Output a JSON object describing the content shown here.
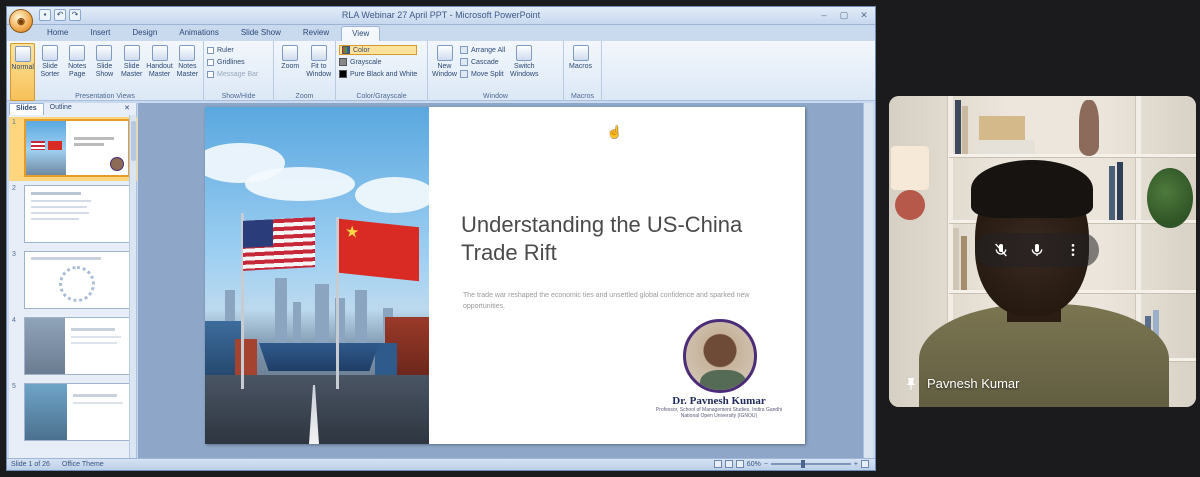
{
  "window": {
    "title": "RLA Webinar 27 April PPT - Microsoft PowerPoint",
    "qat": [
      "save",
      "undo",
      "redo"
    ]
  },
  "ribbon": {
    "tabs": [
      "Home",
      "Insert",
      "Design",
      "Animations",
      "Slide Show",
      "Review",
      "View"
    ],
    "active_tab": "View",
    "groups": {
      "presentation_views": {
        "label": "Presentation Views",
        "buttons": [
          "Normal",
          "Slide Sorter",
          "Notes Page",
          "Slide Show",
          "Slide Master",
          "Handout Master",
          "Notes Master"
        ]
      },
      "show_hide": {
        "label": "Show/Hide",
        "items": [
          "Ruler",
          "Gridlines",
          "Message Bar"
        ]
      },
      "zoom": {
        "label": "Zoom",
        "buttons": [
          "Zoom",
          "Fit to Window"
        ]
      },
      "color_grayscale": {
        "label": "Color/Grayscale",
        "items": [
          "Color",
          "Grayscale",
          "Pure Black and White"
        ]
      },
      "window": {
        "label": "Window",
        "new_window": "New Window",
        "items": [
          "Arrange All",
          "Cascade",
          "Move Split"
        ],
        "switch": "Switch Windows"
      },
      "macros": {
        "label": "Macros",
        "button": "Macros"
      }
    }
  },
  "slides_pane": {
    "tabs": [
      "Slides",
      "Outline"
    ],
    "active_tab": "Slides",
    "slide_numbers": [
      "1",
      "2",
      "3",
      "4",
      "5"
    ],
    "selected": 1
  },
  "slide": {
    "title": "Understanding the US-China Trade Rift",
    "subtitle": "The trade war reshaped the economic ties and unsettled global confidence and sparked new opportunities.",
    "presenter_name": "Dr. Pavnesh Kumar",
    "presenter_role": "Professor, School of Management Studies, Indira Gandhi National Open University (IGNOU)"
  },
  "statusbar": {
    "slide_info": "Slide 1 of 26",
    "theme": "Office Theme",
    "zoom": "60%",
    "zoom_fraction": 0.4
  },
  "video_tile": {
    "participant_name": "Pavnesh Kumar",
    "controls": [
      "mic-off-icon",
      "mic-icon",
      "more-vert-icon"
    ],
    "accent": "#202124"
  }
}
